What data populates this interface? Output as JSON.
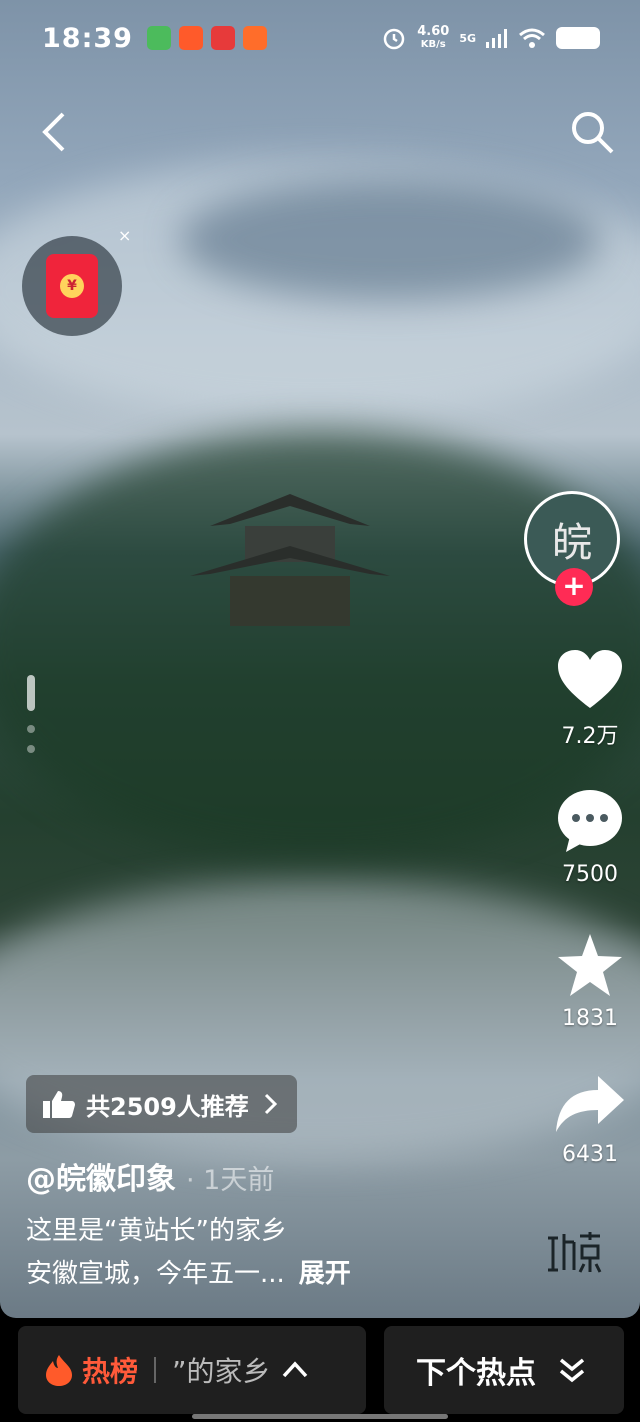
{
  "status_bar": {
    "time": "18:39",
    "net_speed": "4.60",
    "net_unit": "KB/s",
    "network": "5G",
    "icons": [
      "alarm-icon",
      "signal-icon",
      "wifi-icon",
      "battery-icon"
    ]
  },
  "video": {
    "likes": "7.2万",
    "comments": "7500",
    "favorites": "1831",
    "shares": "6431",
    "recommend_label": "共2509人推荐",
    "author": "@皖徽印象",
    "time_ago": "· 1天前",
    "description_line1": "这里是“黄站长”的家乡",
    "description_line2": "安徽宣城，今年五一...",
    "expand_label": "展开",
    "avatar_glyph": "皖",
    "follow_glyph": "+",
    "redpacket_glyph": "¥",
    "close_glyph": "×"
  },
  "bottom_bar": {
    "hot_label": "热榜",
    "hot_scroll_text": "”的家乡",
    "next_label": "下个热点"
  },
  "colors": {
    "accent_red": "#ff2b55",
    "hot_orange": "#ff5a3a"
  }
}
